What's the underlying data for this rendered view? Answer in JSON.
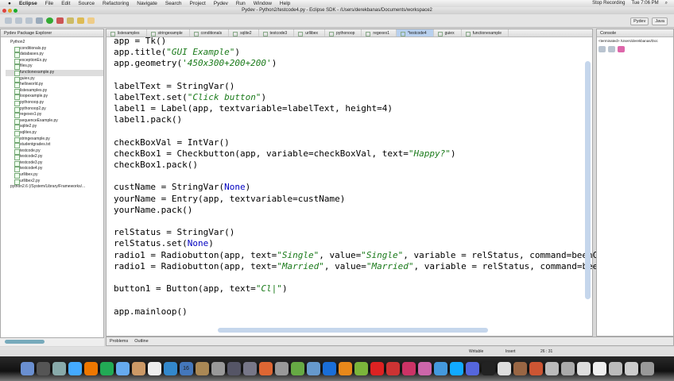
{
  "menubar": {
    "app": "Eclipse",
    "items": [
      "File",
      "Edit",
      "Source",
      "Refactoring",
      "Navigate",
      "Search",
      "Project",
      "Pydev",
      "Run",
      "Window",
      "Help"
    ],
    "status_right": [
      "Stop Recording",
      "Tue 7:06 PM"
    ]
  },
  "window_title": "Pydev - Python2/testcode4.py - Eclipse SDK - /Users/derekbanas/Documents/workspace2",
  "perspectives": [
    "Pydev",
    "Java"
  ],
  "explorer": {
    "title": "Pydev Package Explorer",
    "project": "Python2",
    "files": [
      "conditionals.py",
      "databases.py",
      "exceptionEx.py",
      "files.py",
      "functionexample.py",
      "guiex.py",
      "helloworld.py",
      "listexamples.py",
      "loopexample.py",
      "pythonoop.py",
      "pythonoop2.py",
      "regexex1.py",
      "sequenceExample.py",
      "sqlite2.py",
      "sqlitex.py",
      "stringexample.py",
      "studentgrades.txt",
      "testcode.py",
      "testcode2.py",
      "testcode3.py",
      "testcode4.py",
      "urllibex.py",
      "urllibex2.py"
    ],
    "selected": 4,
    "interpreter": "python2.6  (/System/Library/Frameworks/..."
  },
  "editor_tabs": [
    "listexamples",
    "stringexample",
    "conditionals",
    "sqlite2",
    "testcode3",
    "urllibex",
    "pythonoop",
    "regexex1",
    "*testcode4",
    "guiex",
    "functionexample"
  ],
  "active_tab": 8,
  "code": [
    [
      [
        "app = Tk()",
        ""
      ]
    ],
    [
      [
        "app.title(",
        ""
      ],
      [
        "\"GUI Example\"",
        "s"
      ],
      [
        ")",
        ""
      ]
    ],
    [
      [
        "app.geometry(",
        ""
      ],
      [
        "'450x300+200+200'",
        "s"
      ],
      [
        ")",
        ""
      ]
    ],
    [
      [
        "",
        ""
      ]
    ],
    [
      [
        "labelText = StringVar()",
        ""
      ]
    ],
    [
      [
        "labelText.set(",
        ""
      ],
      [
        "\"Click button\"",
        "s"
      ],
      [
        ")",
        ""
      ]
    ],
    [
      [
        "label1 = Label(app, textvariable=labelText, height=4)",
        ""
      ]
    ],
    [
      [
        "label1.pack()",
        ""
      ]
    ],
    [
      [
        "",
        ""
      ]
    ],
    [
      [
        "checkBoxVal = IntVar()",
        ""
      ]
    ],
    [
      [
        "checkBox1 = Checkbutton(app, variable=checkBoxVal, text=",
        ""
      ],
      [
        "\"Happy?\"",
        "s"
      ],
      [
        ")",
        ""
      ]
    ],
    [
      [
        "checkBox1.pack()",
        ""
      ]
    ],
    [
      [
        "",
        ""
      ]
    ],
    [
      [
        "custName = StringVar(",
        ""
      ],
      [
        "None",
        "k"
      ],
      [
        ")",
        ""
      ]
    ],
    [
      [
        "yourName = Entry(app, textvariable=custName)",
        ""
      ]
    ],
    [
      [
        "yourName.pack()",
        ""
      ]
    ],
    [
      [
        "",
        ""
      ]
    ],
    [
      [
        "relStatus = StringVar()",
        ""
      ]
    ],
    [
      [
        "relStatus.set(",
        ""
      ],
      [
        "None",
        "k"
      ],
      [
        ")",
        ""
      ]
    ],
    [
      [
        "radio1 = Radiobutton(app, text=",
        ""
      ],
      [
        "\"Single\"",
        "s"
      ],
      [
        ", value=",
        ""
      ],
      [
        "\"Single\"",
        "s"
      ],
      [
        ", variable = relStatus, command=beenCli",
        ""
      ]
    ],
    [
      [
        "radio1 = Radiobutton(app, text=",
        ""
      ],
      [
        "\"Married\"",
        "s"
      ],
      [
        ", value=",
        ""
      ],
      [
        "\"Married\"",
        "s"
      ],
      [
        ", variable = relStatus, command=beenCl",
        ""
      ]
    ],
    [
      [
        "",
        ""
      ]
    ],
    [
      [
        "button1 = Button(app, text=",
        ""
      ],
      [
        "\"Cl|\"",
        "s"
      ],
      [
        ")",
        ""
      ]
    ],
    [
      [
        "",
        ""
      ]
    ],
    [
      [
        "app.mainloop()",
        ""
      ]
    ]
  ],
  "console": {
    "title": "Console",
    "text": "<terminated> /Users/derekbanas/Doc"
  },
  "bottom_tabs": [
    "Problems",
    "Outline"
  ],
  "status": {
    "mode": "Writable",
    "insert": "Insert",
    "position": "26 : 31"
  },
  "dock": {
    "calendar_day": "16"
  }
}
